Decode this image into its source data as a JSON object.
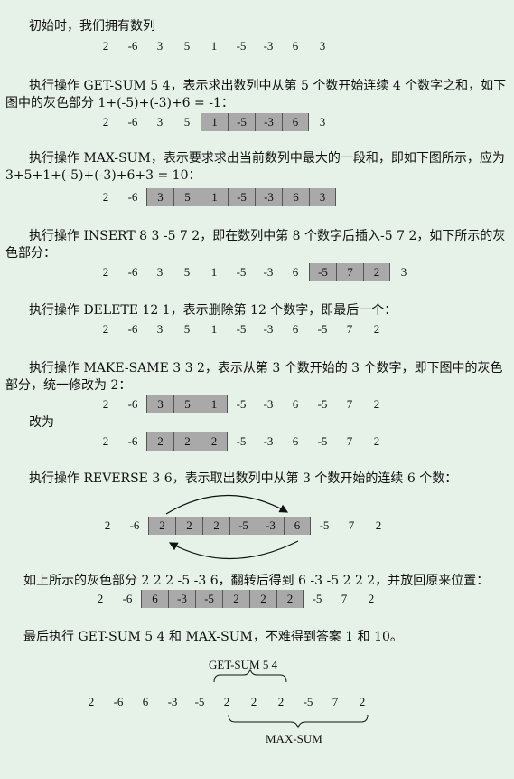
{
  "paragraphs": {
    "p1": "初始时，我们拥有数列",
    "p2": "执行操作 GET-SUM 5 4，表示求出数列中从第 5 个数开始连续 4 个数字之和，如下图中的灰色部分 1+(-5)+(-3)+6 = -1：",
    "p3": "执行操作 MAX-SUM，表示要求求出当前数列中最大的一段和，即如下图所示，应为 3+5+1+(-5)+(-3)+6+3 = 10：",
    "p4": "执行操作 INSERT 8 3 -5 7 2，即在数列中第 8 个数字后插入-5 7 2，如下所示的灰色部分：",
    "p5": "执行操作 DELETE 12 1，表示删除第 12 个数字，即最后一个：",
    "p6": "执行操作 MAKE-SAME 3 3 2，表示从第 3 个数开始的 3 个数字，即下图中的灰色部分，统一修改为 2：",
    "p6b": "改为",
    "p7": "执行操作 REVERSE 3 6，表示取出数列中从第 3 个数开始的连续 6 个数：",
    "p8": "如上所示的灰色部分 2 2 2 -5 -3 6，翻转后得到 6 -3 -5 2 2 2，并放回原来位置：",
    "p9": "最后执行 GET-SUM 5 4 和 MAX-SUM，不难得到答案 1 和 10。"
  },
  "sequences": [
    {
      "values": [
        "2",
        "-6",
        "3",
        "5",
        "1",
        "-5",
        "-3",
        "6",
        "3"
      ],
      "highlight": []
    },
    {
      "values": [
        "2",
        "-6",
        "3",
        "5",
        "1",
        "-5",
        "-3",
        "6",
        "3"
      ],
      "highlight": [
        4,
        5,
        6,
        7
      ]
    },
    {
      "values": [
        "2",
        "-6",
        "3",
        "5",
        "1",
        "-5",
        "-3",
        "6",
        "3"
      ],
      "highlight": [
        2,
        3,
        4,
        5,
        6,
        7,
        8
      ]
    },
    {
      "values": [
        "2",
        "-6",
        "3",
        "5",
        "1",
        "-5",
        "-3",
        "6",
        "-5",
        "7",
        "2",
        "3"
      ],
      "highlight": [
        8,
        9,
        10
      ]
    },
    {
      "values": [
        "2",
        "-6",
        "3",
        "5",
        "1",
        "-5",
        "-3",
        "6",
        "-5",
        "7",
        "2"
      ],
      "highlight": []
    },
    {
      "values": [
        "2",
        "-6",
        "3",
        "5",
        "1",
        "-5",
        "-3",
        "6",
        "-5",
        "7",
        "2"
      ],
      "highlight": [
        2,
        3,
        4
      ]
    },
    {
      "values": [
        "2",
        "-6",
        "2",
        "2",
        "2",
        "-5",
        "-3",
        "6",
        "-5",
        "7",
        "2"
      ],
      "highlight": [
        2,
        3,
        4
      ]
    },
    {
      "values": [
        "2",
        "-6",
        "2",
        "2",
        "2",
        "-5",
        "-3",
        "6",
        "-5",
        "7",
        "2"
      ],
      "highlight": [
        2,
        3,
        4,
        5,
        6,
        7
      ]
    },
    {
      "values": [
        "2",
        "-6",
        "6",
        "-3",
        "-5",
        "2",
        "2",
        "2",
        "-5",
        "7",
        "2"
      ],
      "highlight": [
        2,
        3,
        4,
        5,
        6,
        7
      ]
    },
    {
      "values": [
        "2",
        "-6",
        "6",
        "-3",
        "-5",
        "2",
        "2",
        "2",
        "-5",
        "7",
        "2"
      ],
      "highlight": []
    }
  ],
  "labels": {
    "get_sum": "GET-SUM 5 4",
    "max_sum": "MAX-SUM"
  }
}
